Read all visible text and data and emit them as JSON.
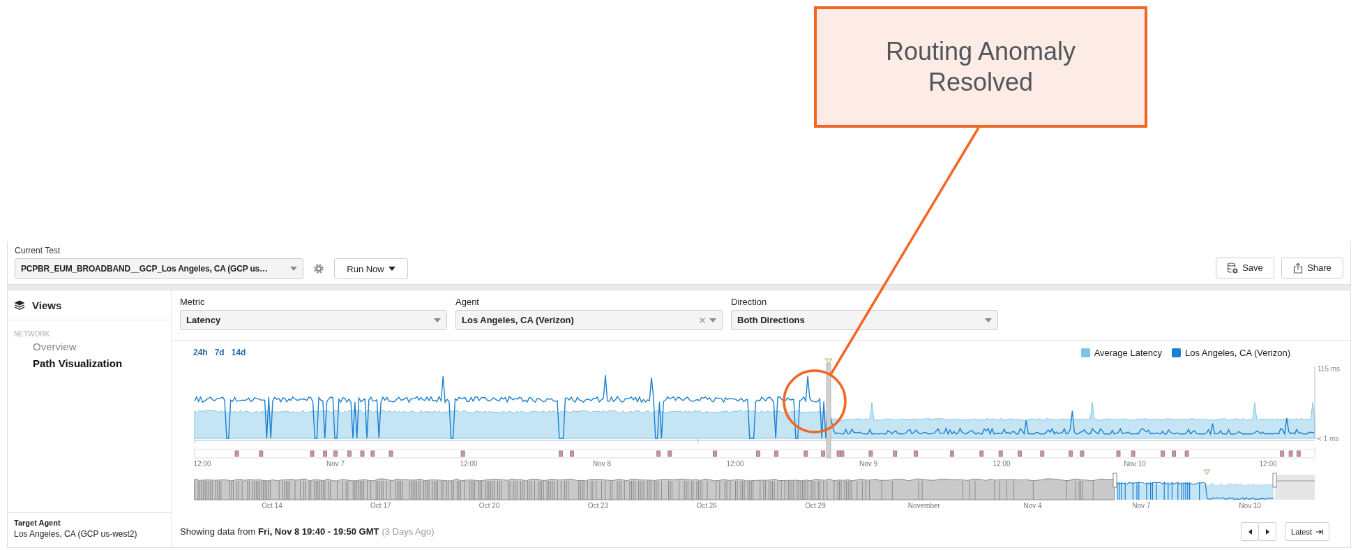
{
  "annotation": {
    "text": "Routing Anomaly Resolved"
  },
  "toolbar": {
    "label": "Current Test",
    "test_select": "PCPBR_EUM_BROADBAND__GCP_Los Angeles, CA (GCP us…",
    "run_button": "Run Now",
    "save_button": "Save",
    "share_button": "Share"
  },
  "sidebar": {
    "title": "Views",
    "section": "NETWORK",
    "items": [
      {
        "label": "Overview",
        "selected": false
      },
      {
        "label": "Path Visualization",
        "selected": true
      }
    ],
    "target_agent": {
      "label": "Target Agent",
      "value": "Los Angeles, CA (GCP us-west2)"
    }
  },
  "filters": [
    {
      "label": "Metric",
      "value": "Latency",
      "clearable": false
    },
    {
      "label": "Agent",
      "value": "Los Angeles, CA (Verizon)",
      "clearable": true
    },
    {
      "label": "Direction",
      "value": "Both Directions",
      "clearable": false
    }
  ],
  "ranges": [
    "24h",
    "7d",
    "14d"
  ],
  "legend": [
    {
      "label": "Average Latency",
      "color": "#7fc4e6"
    },
    {
      "label": "Los Angeles, CA (Verizon)",
      "color": "#1a7fd0"
    }
  ],
  "chart": {
    "y_labels": [
      "115 ms",
      "< 1 ms"
    ],
    "x_labels": [
      "12:00",
      "Nov 7",
      "12:00",
      "Nov 8",
      "12:00",
      "Nov 9",
      "12:00",
      "Nov 10",
      "12:00"
    ],
    "overview_labels": [
      "Oct 14",
      "Oct 17",
      "Oct 20",
      "Oct 23",
      "Oct 26",
      "Oct 29",
      "November",
      "Nov 4",
      "Nov 7",
      "Nov 10"
    ]
  },
  "footer": {
    "text": "Showing data from **Fri, Nov 8 19:40 - 19:50 GMT**",
    "age": "(3 Days Ago)",
    "latest_button": "Latest"
  }
}
